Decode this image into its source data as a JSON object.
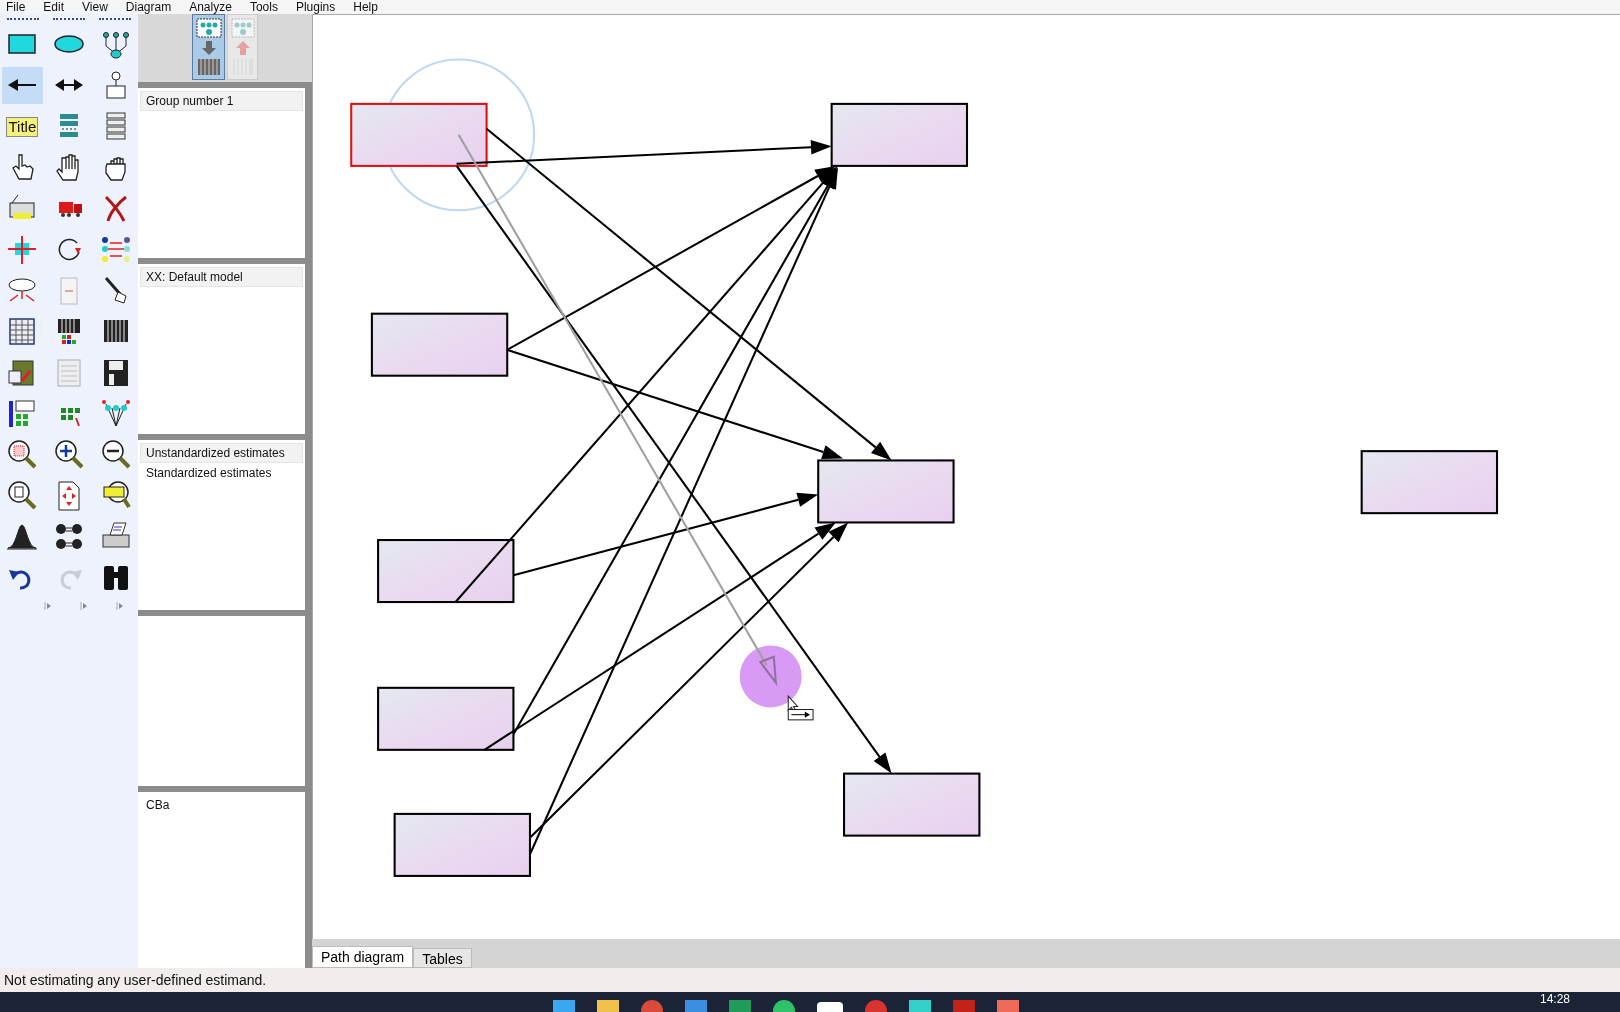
{
  "menu": [
    "File",
    "Edit",
    "View",
    "Diagram",
    "Analyze",
    "Tools",
    "Plugins",
    "Help"
  ],
  "toolbox": {
    "tools": [
      {
        "selected": false
      },
      {
        "selected": false
      },
      {
        "selected": false
      },
      {
        "selected": true
      },
      {
        "selected": false
      },
      {
        "selected": false
      },
      {
        "selected": false,
        "label": "Title"
      },
      {
        "selected": false
      },
      {
        "selected": false
      },
      {
        "selected": false
      },
      {
        "selected": false
      },
      {
        "selected": false
      },
      {
        "selected": false
      },
      {
        "selected": false
      },
      {
        "selected": false
      },
      {
        "selected": false
      },
      {
        "selected": false
      },
      {
        "selected": false
      },
      {
        "selected": false
      },
      {
        "selected": false
      },
      {
        "selected": false
      },
      {
        "selected": false
      },
      {
        "selected": false
      },
      {
        "selected": false
      },
      {
        "selected": false
      },
      {
        "selected": false
      },
      {
        "selected": false
      },
      {
        "selected": false
      },
      {
        "selected": false
      },
      {
        "selected": false
      },
      {
        "selected": false
      },
      {
        "selected": false
      },
      {
        "selected": false
      },
      {
        "selected": false
      },
      {
        "selected": false
      },
      {
        "selected": false
      },
      {
        "selected": false
      },
      {
        "selected": false
      },
      {
        "selected": false
      },
      {
        "selected": false
      },
      {
        "selected": false
      },
      {
        "selected": false
      }
    ]
  },
  "panels": [
    {
      "items": [
        {
          "label": "Group number 1",
          "selected": true
        }
      ]
    },
    {
      "items": [
        {
          "label": "XX: Default model",
          "selected": true
        }
      ]
    },
    {
      "items": [
        {
          "label": "Unstandardized estimates",
          "selected": true
        },
        {
          "label": "Standardized estimates",
          "selected": false
        }
      ]
    },
    {
      "items": [
        {
          "label": "CBa",
          "selected": false
        }
      ]
    }
  ],
  "diagram": {
    "nodes": [
      {
        "selected": true
      },
      {
        "selected": false
      },
      {
        "selected": false
      },
      {
        "selected": false
      },
      {
        "selected": false
      },
      {
        "selected": false
      },
      {
        "selected": false
      },
      {
        "selected": false
      },
      {
        "selected": false
      }
    ]
  },
  "tabs": [
    {
      "label": "Path diagram",
      "selected": true
    },
    {
      "label": "Tables",
      "selected": false
    }
  ],
  "status_bar": "Not estimating any user-defined estimand.",
  "taskbar": {
    "time": "14:28"
  }
}
